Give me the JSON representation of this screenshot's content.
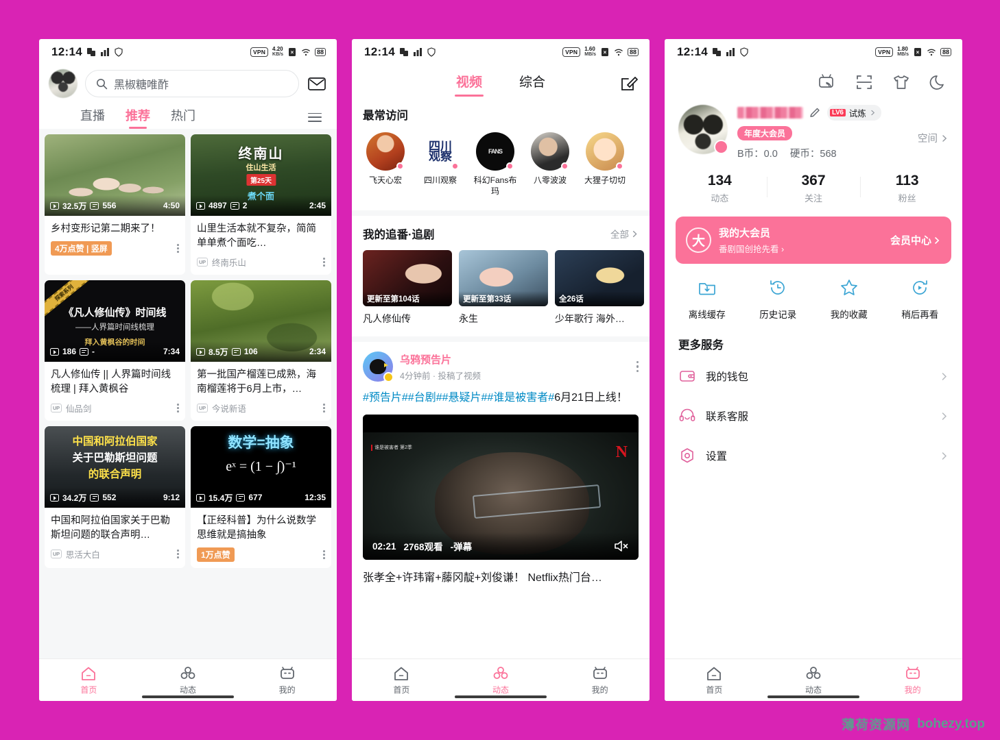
{
  "watermark": {
    "cn": "薄荷资源网",
    "url": "bohezy.top"
  },
  "panel1": {
    "status": {
      "time": "12:14",
      "vpn": "VPN",
      "speed": "4.20",
      "speed_unit": "KB/s",
      "battery": "88"
    },
    "search": {
      "value": "黑椒糖唯酢",
      "icon": "search-icon"
    },
    "mail_icon": "mail-icon",
    "tabs": [
      {
        "label": "直播",
        "active": false
      },
      {
        "label": "推荐",
        "active": true
      },
      {
        "label": "热门",
        "active": false
      }
    ],
    "cards": [
      {
        "views": "32.5万",
        "danmaku": "556",
        "duration": "4:50",
        "title": "乡村变形记第二期来了！",
        "badge": "4万点赞 | 竖屏",
        "up": null
      },
      {
        "views": "4897",
        "danmaku": "2",
        "duration": "2:45",
        "title": "山里生活本就不复杂，简简单单煮个面吃…",
        "badge": null,
        "up": "终南乐山",
        "art": {
          "title": "终南山",
          "sub": "住山生活",
          "episode": "第25天",
          "cook": "煮个面"
        }
      },
      {
        "views": "186",
        "danmaku": "-",
        "duration": "7:34",
        "title": "凡人修仙传 || 人界篇时间线梳理 | 拜入黄枫谷",
        "badge": null,
        "up": "仙品剑",
        "art": {
          "ribbon": "探索系列",
          "l1": "《凡人修仙传》时间线",
          "l2": "——人界篇时间线梳理",
          "l3": "拜入黄枫谷的时间"
        }
      },
      {
        "views": "8.5万",
        "danmaku": "106",
        "duration": "2:34",
        "title": "第一批国产榴莲已成熟，海南榴莲将于6月上市，…",
        "badge": null,
        "up": "今说新语"
      },
      {
        "views": "34.2万",
        "danmaku": "552",
        "duration": "9:12",
        "title": "中国和阿拉伯国家关于巴勒斯坦问题的联合声明…",
        "badge": null,
        "up": "思活大白",
        "art": {
          "n1": "中国和阿拉伯国家",
          "n2": "关于巴勒斯坦问题",
          "n3": "的联合声明"
        }
      },
      {
        "views": "15.4万",
        "danmaku": "677",
        "duration": "12:35",
        "title": "【正经科普】为什么说数学思维就是搞抽象",
        "badge": "1万点赞",
        "up": null,
        "art": {
          "m1": "数学=抽象",
          "m2": "eˣ = (1 − ∫)⁻¹"
        }
      }
    ],
    "nav": [
      {
        "label": "首页",
        "icon": "home-icon",
        "active": true
      },
      {
        "label": "动态",
        "icon": "dynamic-icon",
        "active": false
      },
      {
        "label": "我的",
        "icon": "tv-icon",
        "active": false
      }
    ]
  },
  "panel2": {
    "status": {
      "time": "12:14",
      "vpn": "VPN",
      "speed": "1.60",
      "speed_unit": "MB/s",
      "battery": "88"
    },
    "tabs": [
      {
        "label": "视频",
        "active": true
      },
      {
        "label": "综合",
        "active": false
      }
    ],
    "compose_icon": "compose-icon",
    "frequent": {
      "title": "最常访问",
      "ups": [
        {
          "name": "飞天心宏"
        },
        {
          "name": "四川观察"
        },
        {
          "name": "科幻Fans布玛"
        },
        {
          "name": "八零波波"
        },
        {
          "name": "大狸子切切"
        }
      ]
    },
    "bangumi": {
      "title": "我的追番·追剧",
      "more": "全部",
      "items": [
        {
          "title": "凡人修仙传",
          "episode": "更新至第104话"
        },
        {
          "title": "永生",
          "episode": "更新至第33话"
        },
        {
          "title": "少年歌行 海外…",
          "episode": "全26话"
        }
      ]
    },
    "post": {
      "author": "乌鸦预告片",
      "meta": "4分钟前 · 投稿了视频",
      "tags": "#预告片##台剧##悬疑片##谁是被害者#",
      "text_tail": "6月21日上线！",
      "video": {
        "time": "02:21",
        "views": "2768观看",
        "danmaku": "-弹幕",
        "logo": "N",
        "watermark": "谁是被害者 第2季"
      },
      "title": "张孝全+许玮甯+藤冈靛+刘俊谦！ Netflix热门台…"
    },
    "nav": [
      {
        "label": "首页",
        "icon": "home-icon",
        "active": false
      },
      {
        "label": "动态",
        "icon": "dynamic-icon",
        "active": true
      },
      {
        "label": "我的",
        "icon": "tv-icon",
        "active": false
      }
    ]
  },
  "panel3": {
    "status": {
      "time": "12:14",
      "vpn": "VPN",
      "speed": "1.80",
      "speed_unit": "MB/s",
      "battery": "88"
    },
    "topicons": [
      "cast-icon",
      "scan-icon",
      "shirt-icon",
      "moon-icon"
    ],
    "profile": {
      "level_tag": "LV6",
      "level_text": "试炼",
      "vip_badge": "年度大会员",
      "bcoin_label": "B币：0.0",
      "coin_label": "硬币：568",
      "space": "空间"
    },
    "stats": [
      {
        "num": "134",
        "label": "动态"
      },
      {
        "num": "367",
        "label": "关注"
      },
      {
        "num": "113",
        "label": "粉丝"
      }
    ],
    "vipcard": {
      "sigil": "大",
      "title": "我的大会员",
      "subtitle": "番剧国创抢先看 ›",
      "action": "会员中心"
    },
    "quick": [
      {
        "label": "离线缓存",
        "icon": "download-folder-icon"
      },
      {
        "label": "历史记录",
        "icon": "history-icon"
      },
      {
        "label": "我的收藏",
        "icon": "star-icon"
      },
      {
        "label": "稍后再看",
        "icon": "watch-later-icon"
      }
    ],
    "more_services_title": "更多服务",
    "menu": [
      {
        "label": "我的钱包",
        "icon": "wallet-icon"
      },
      {
        "label": "联系客服",
        "icon": "headset-icon"
      },
      {
        "label": "设置",
        "icon": "settings-icon"
      }
    ],
    "nav": [
      {
        "label": "首页",
        "icon": "home-icon",
        "active": false
      },
      {
        "label": "动态",
        "icon": "dynamic-icon",
        "active": false
      },
      {
        "label": "我的",
        "icon": "tv-icon",
        "active": true
      }
    ]
  }
}
